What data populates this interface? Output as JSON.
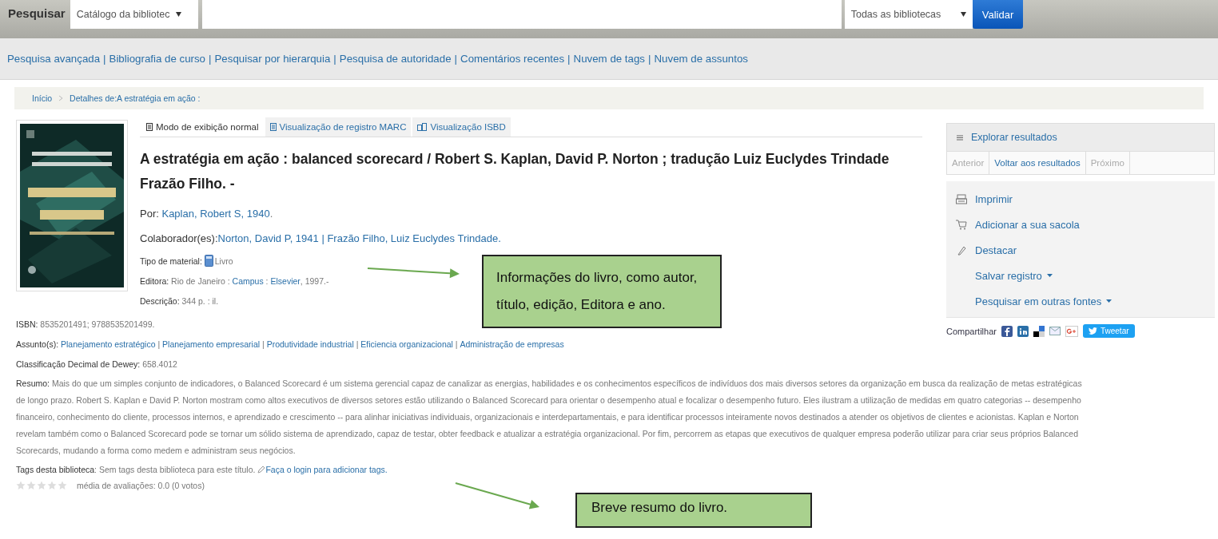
{
  "search_bar": {
    "label": "Pesquisar",
    "scope": "Catálogo da bibliotec",
    "library": "Todas as bibliotecas",
    "button": "Validar"
  },
  "nav_separator": "|",
  "nav_links": [
    "Pesquisa avançada",
    "Bibliografia de curso",
    "Pesquisar por hierarquia",
    "Pesquisa de autoridade",
    "Comentários recentes",
    "Nuvem de tags",
    "Nuvem de assuntos"
  ],
  "breadcrumb": [
    {
      "label": "Início"
    },
    {
      "label": "Detalhes de:A estratégia em ação :"
    }
  ],
  "tabs": [
    {
      "label": "Modo de exibição normal",
      "selected": true
    },
    {
      "label": "Visualização de registro MARC",
      "selected": false
    },
    {
      "label": "Visualização ISBD",
      "selected": false
    }
  ],
  "title": "A estratégia em ação : balanced scorecard / Robert S. Kaplan, David P. Norton ; tradução Luiz Euclydes Trindade Frazão Filho. -",
  "fields": [
    {
      "kind": "large",
      "label": "Por: ",
      "parts": [
        {
          "text": "Kaplan, Robert S, 1940",
          "link": true
        },
        {
          "text": ".",
          "link": false
        }
      ]
    },
    {
      "kind": "large",
      "label": "Colaborador(es):",
      "parts": [
        {
          "text": "Norton, David P, 1941 | Frazão Filho, Luiz Euclydes Trindade.",
          "link": true
        }
      ]
    },
    {
      "kind": "material",
      "label": "Tipo de material: ",
      "parts": [
        {
          "text": "Livro",
          "link": false
        }
      ]
    },
    {
      "kind": "small",
      "label": "Editora: ",
      "parts": [
        {
          "text": "Rio de Janeiro : ",
          "link": false
        },
        {
          "text": "Campus",
          "link": true
        },
        {
          "text": " : ",
          "link": false
        },
        {
          "text": "Elsevier",
          "link": true
        },
        {
          "text": ", 1997.-",
          "link": false
        }
      ]
    },
    {
      "kind": "small",
      "label": "Descrição: ",
      "parts": [
        {
          "text": "344 p. : il.",
          "link": false
        }
      ]
    }
  ],
  "details": [
    {
      "label": "ISBN: ",
      "parts": [
        {
          "text": "8535201491; 9788535201499.",
          "link": false
        }
      ]
    },
    {
      "label": "Assunto(s): ",
      "parts": [
        {
          "text": "Planejamento estratégico",
          "link": true
        },
        {
          "text": " | ",
          "link": false
        },
        {
          "text": "Planejamento empresarial",
          "link": true
        },
        {
          "text": " | ",
          "link": false
        },
        {
          "text": "Produtividade industrial",
          "link": true
        },
        {
          "text": " | ",
          "link": false
        },
        {
          "text": "Eficiencia organizacional",
          "link": true
        },
        {
          "text": " | ",
          "link": false
        },
        {
          "text": "Administração de empresas",
          "link": true
        }
      ]
    },
    {
      "label": "Classificação Decimal de Dewey: ",
      "parts": [
        {
          "text": "658.4012",
          "link": false
        }
      ]
    },
    {
      "label": "Resumo: ",
      "parts": [
        {
          "text": "Mais do que um simples conjunto de indicadores, o Balanced Scorecard é um sistema gerencial capaz de canalizar as energias, habilidades e os conhecimentos específicos de indivíduos dos mais diversos setores da organização em busca da realização de metas estratégicas de longo prazo. Robert S. Kaplan e David P. Norton mostram como altos executivos de diversos setores estão utilizando o Balanced Scorecard para orientar o desempenho atual e focalizar o desempenho futuro. Eles ilustram a utilização de medidas em quatro categorias -- desempenho financeiro, conhecimento do cliente, processos internos, e aprendizado e crescimento -- para alinhar iniciativas individuais, organizacionais e interdepartamentais, e para identificar processos inteiramente novos destinados a atender os objetivos de clientes e acionistas. Kaplan e Norton revelam também como o Balanced Scorecard pode se tornar um sólido sistema de aprendizado, capaz de testar, obter feedback e atualizar a estratégia organizacional. Por fim, percorrem as etapas que executivos de qualquer empresa poderão utilizar para criar seus próprios Balanced Scorecards, mudando a forma como medem e administram seus negócios.",
          "link": false
        }
      ]
    }
  ],
  "tags": {
    "label": "Tags desta biblioteca",
    "text": ": Sem tags desta biblioteca para este título.",
    "login_link": "Faça o login para adicionar tags."
  },
  "rating": {
    "stars": 0,
    "text": "média de avaliações: 0.0 (0 votos)"
  },
  "sidebar": {
    "title": "Explorar resultados",
    "pager": [
      {
        "label": "Anterior",
        "disabled": true
      },
      {
        "label": "Voltar aos resultados",
        "disabled": false
      },
      {
        "label": "Próximo",
        "disabled": true
      }
    ],
    "actions": [
      {
        "kind": "print",
        "label": "Imprimir"
      },
      {
        "kind": "cart",
        "label": "Adicionar a sua sacola"
      },
      {
        "kind": "highlight",
        "label": "Destacar"
      },
      {
        "kind": "menu",
        "label": "Salvar registro"
      },
      {
        "kind": "menu",
        "label": "Pesquisar em outras fontes"
      }
    ],
    "share_label": "Compartilhar",
    "tweet": "Tweetar"
  },
  "annotations": [
    {
      "text": "Informações do livro, como autor, título, edição, Editora e ano."
    },
    {
      "text": "Breve resumo do livro."
    }
  ]
}
